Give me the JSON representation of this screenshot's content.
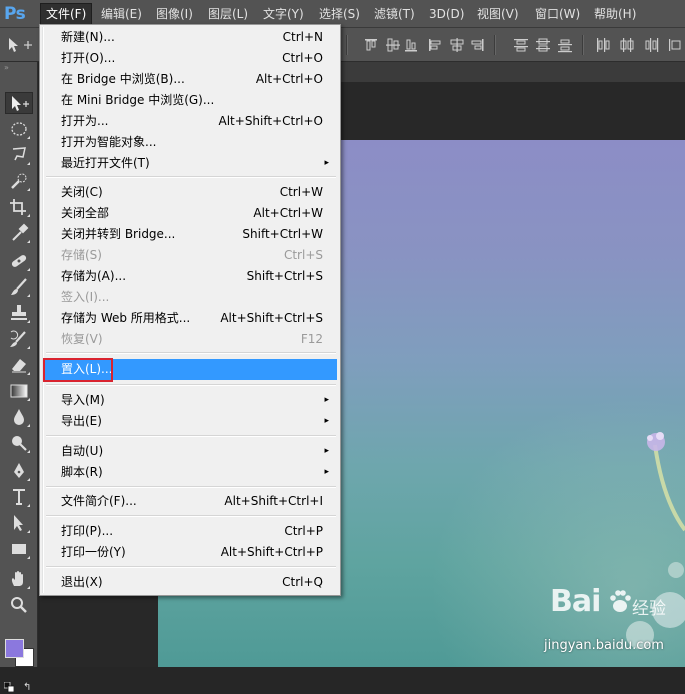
{
  "app": {
    "logo": "Ps"
  },
  "menubar": {
    "items": [
      "文件(F)",
      "编辑(E)",
      "图像(I)",
      "图层(L)",
      "文字(Y)",
      "选择(S)",
      "滤镜(T)",
      "3D(D)",
      "视图(V)",
      "窗口(W)",
      "帮助(H)"
    ],
    "active": "文件(F)"
  },
  "file_menu": {
    "new": {
      "label": "新建(N)...",
      "shortcut": "Ctrl+N"
    },
    "open": {
      "label": "打开(O)...",
      "shortcut": "Ctrl+O"
    },
    "browse_bridge": {
      "label": "在 Bridge 中浏览(B)...",
      "shortcut": "Alt+Ctrl+O"
    },
    "browse_mini_bridge": {
      "label": "在 Mini Bridge 中浏览(G)...",
      "shortcut": ""
    },
    "open_as": {
      "label": "打开为...",
      "shortcut": "Alt+Shift+Ctrl+O"
    },
    "open_smart": {
      "label": "打开为智能对象...",
      "shortcut": ""
    },
    "recent": {
      "label": "最近打开文件(T)",
      "shortcut": ""
    },
    "close": {
      "label": "关闭(C)",
      "shortcut": "Ctrl+W"
    },
    "close_all": {
      "label": "关闭全部",
      "shortcut": "Alt+Ctrl+W"
    },
    "close_to_bridge": {
      "label": "关闭并转到 Bridge...",
      "shortcut": "Shift+Ctrl+W"
    },
    "save": {
      "label": "存储(S)",
      "shortcut": "Ctrl+S"
    },
    "save_as": {
      "label": "存储为(A)...",
      "shortcut": "Shift+Ctrl+S"
    },
    "check_in": {
      "label": "签入(I)...",
      "shortcut": ""
    },
    "save_web": {
      "label": "存储为 Web 所用格式...",
      "shortcut": "Alt+Shift+Ctrl+S"
    },
    "revert": {
      "label": "恢复(V)",
      "shortcut": "F12"
    },
    "place": {
      "label": "置入(L)...",
      "shortcut": ""
    },
    "import": {
      "label": "导入(M)",
      "shortcut": ""
    },
    "export": {
      "label": "导出(E)",
      "shortcut": ""
    },
    "automate": {
      "label": "自动(U)",
      "shortcut": ""
    },
    "scripts": {
      "label": "脚本(R)",
      "shortcut": ""
    },
    "file_info": {
      "label": "文件简介(F)...",
      "shortcut": "Alt+Shift+Ctrl+I"
    },
    "print": {
      "label": "打印(P)...",
      "shortcut": "Ctrl+P"
    },
    "print_one": {
      "label": "打印一份(Y)",
      "shortcut": "Alt+Shift+Ctrl+P"
    },
    "exit": {
      "label": "退出(X)",
      "shortcut": "Ctrl+Q"
    },
    "submenu_arrow": "▸"
  },
  "watermark": {
    "logo": "Bai  ",
    "brand": "经验",
    "url": "jingyan.baidu.com"
  },
  "colors": {
    "menu_highlight": "#3399ff",
    "annotation_box": "#d9232f",
    "foreground_swatch": "#8b78de",
    "background_swatch": "#ffffff",
    "ps_logo": "#58a6ef"
  }
}
